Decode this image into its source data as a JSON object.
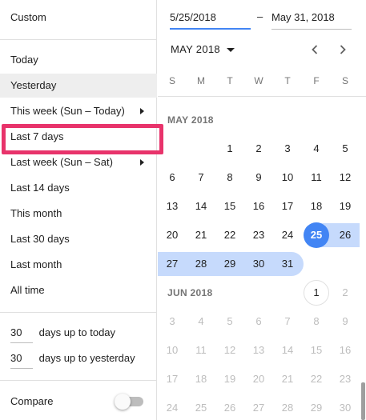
{
  "left": {
    "custom_label": "Custom",
    "options": [
      {
        "label": "Today",
        "selected": false,
        "has_arrow": false
      },
      {
        "label": "Yesterday",
        "selected": true,
        "has_arrow": false
      },
      {
        "label": "This week (Sun – Today)",
        "selected": false,
        "has_arrow": true
      },
      {
        "label": "Last 7 days",
        "selected": false,
        "has_arrow": false
      },
      {
        "label": "Last week (Sun – Sat)",
        "selected": false,
        "has_arrow": true
      },
      {
        "label": "Last 14 days",
        "selected": false,
        "has_arrow": false
      },
      {
        "label": "This month",
        "selected": false,
        "has_arrow": false
      },
      {
        "label": "Last 30 days",
        "selected": false,
        "has_arrow": false
      },
      {
        "label": "Last month",
        "selected": false,
        "has_arrow": false
      },
      {
        "label": "All time",
        "selected": false,
        "has_arrow": false
      }
    ],
    "days_up_to_today": {
      "value": "30",
      "label": "days up to today"
    },
    "days_up_to_yesterday": {
      "value": "30",
      "label": "days up to yesterday"
    },
    "compare_label": "Compare",
    "compare_on": false,
    "highlight_color": "#e8336b"
  },
  "right": {
    "start_date": "5/25/2018",
    "end_date": "May 31, 2018",
    "dash": "–",
    "month_selector": "MAY 2018",
    "weekdays": [
      "S",
      "M",
      "T",
      "W",
      "T",
      "F",
      "S"
    ],
    "months": [
      {
        "label": "MAY 2018",
        "rows": [
          [
            "",
            "",
            "1",
            "2",
            "3",
            "4",
            "5"
          ],
          [
            "6",
            "7",
            "8",
            "9",
            "10",
            "11",
            "12"
          ],
          [
            "13",
            "14",
            "15",
            "16",
            "17",
            "18",
            "19"
          ],
          [
            "20",
            "21",
            "22",
            "23",
            "24",
            "25",
            "26"
          ],
          [
            "27",
            "28",
            "29",
            "30",
            "31",
            "",
            ""
          ]
        ]
      },
      {
        "label": "JUN 2018",
        "rows": [
          [
            "",
            "",
            "",
            "",
            "",
            "1",
            "2"
          ],
          [
            "3",
            "4",
            "5",
            "6",
            "7",
            "8",
            "9"
          ],
          [
            "10",
            "11",
            "12",
            "13",
            "14",
            "15",
            "16"
          ],
          [
            "17",
            "18",
            "19",
            "20",
            "21",
            "22",
            "23"
          ],
          [
            "24",
            "25",
            "26",
            "27",
            "28",
            "29",
            "30"
          ]
        ]
      }
    ],
    "selected_start_day": "25",
    "accent_color": "#4285f4",
    "range_color": "#c6dafc"
  }
}
